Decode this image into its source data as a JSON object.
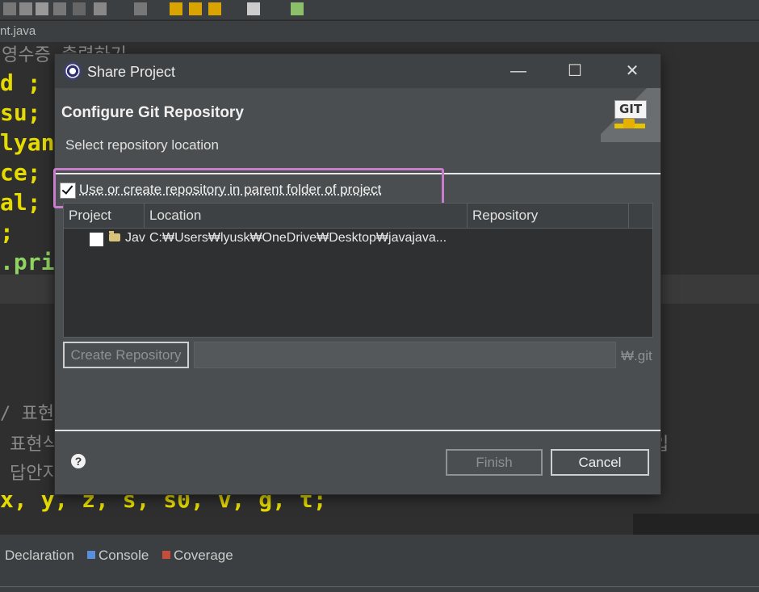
{
  "editor": {
    "tab_label": "nt.java",
    "comment_top": "영수증 출력하기",
    "code_lines": [
      "d ;",
      "su;",
      "lyang",
      "ce;",
      "al;",
      ";",
      ".prin"
    ],
    "comment_mid": "/ 표현",
    "comment_line2": "표현식",
    "comment_line3": "답안지",
    "comment_tail": "입",
    "code_bottom": "x, y, z, s, s0, v, g, t;"
  },
  "bottom_tabs": [
    {
      "label": "Declaration"
    },
    {
      "label": "Console"
    },
    {
      "label": "Coverage"
    }
  ],
  "dialog": {
    "title": "Share Project",
    "window_controls": {
      "minimize": "—",
      "maximize": "☐",
      "close": "✕"
    },
    "header_title": "Configure Git Repository",
    "header_description": "Select repository location",
    "git_logo_text": "GIT",
    "use_parent_checkbox": {
      "label": "Use or create repository in parent folder of project",
      "checked": true
    },
    "table": {
      "columns": [
        "Project",
        "Location",
        "Repository"
      ],
      "rows": [
        {
          "project": "Jav",
          "location": "C:₩Users₩lyusk₩OneDrive₩Desktop₩javajava...",
          "repository": "",
          "checked": false
        }
      ]
    },
    "create_repository_label": "Create Repository",
    "repository_path_value": "",
    "git_suffix": "₩.git",
    "help_icon": "?",
    "finish_label": "Finish",
    "cancel_label": "Cancel"
  },
  "colors": {
    "highlight_border": "#c77dcb",
    "code_yellow": "#e6db00"
  }
}
